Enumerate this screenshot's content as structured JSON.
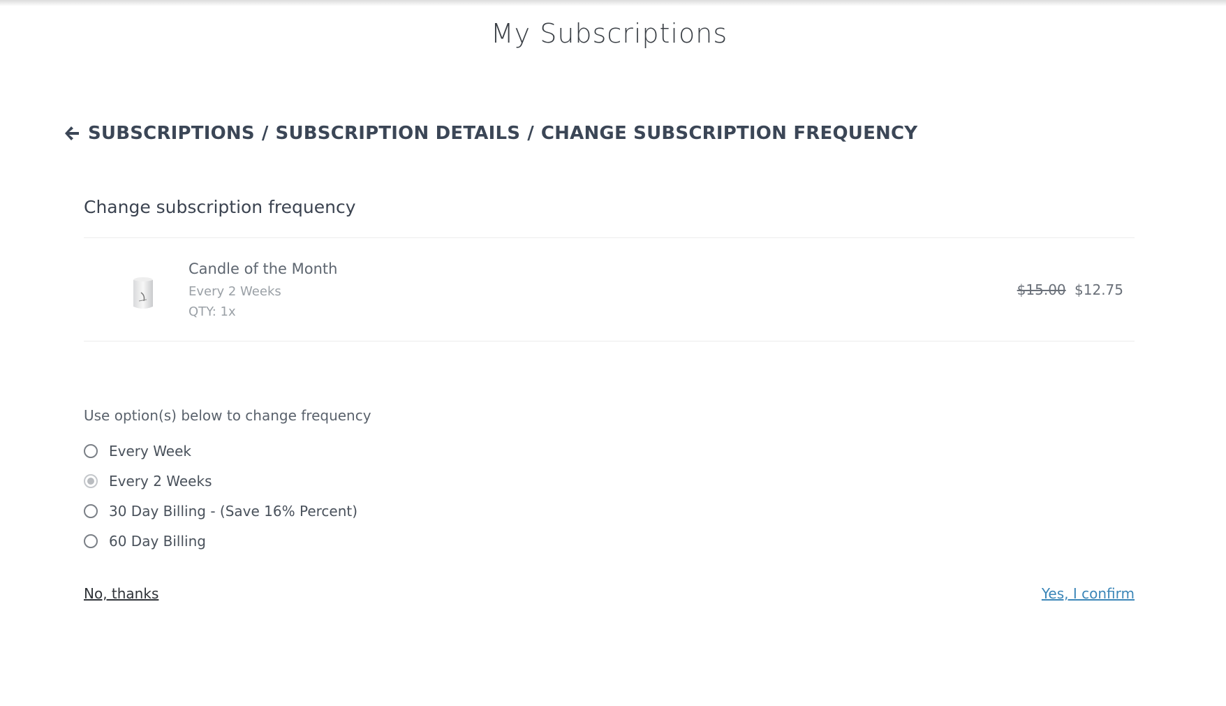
{
  "page": {
    "title": "My Subscriptions"
  },
  "breadcrumb": {
    "items": [
      "SUBSCRIPTIONS",
      "SUBSCRIPTION DETAILS",
      "CHANGE SUBSCRIPTION FREQUENCY"
    ],
    "separator": "/"
  },
  "card": {
    "title": "Change subscription frequency"
  },
  "product": {
    "name": "Candle of the Month",
    "frequency": "Every 2 Weeks",
    "quantity": "QTY: 1x",
    "price_original": "$15.00",
    "price_current": "$12.75"
  },
  "frequency_options": {
    "label": "Use option(s) below to change frequency",
    "items": [
      {
        "label": "Every Week",
        "selected": false
      },
      {
        "label": "Every 2 Weeks",
        "selected": true
      },
      {
        "label": "30 Day Billing - (Save 16% Percent)",
        "selected": false
      },
      {
        "label": "60 Day Billing",
        "selected": false
      }
    ]
  },
  "actions": {
    "decline_label": "No, thanks",
    "confirm_label": "Yes, I confirm"
  },
  "colors": {
    "link": "#3b86b8",
    "heading": "#3b4656"
  }
}
